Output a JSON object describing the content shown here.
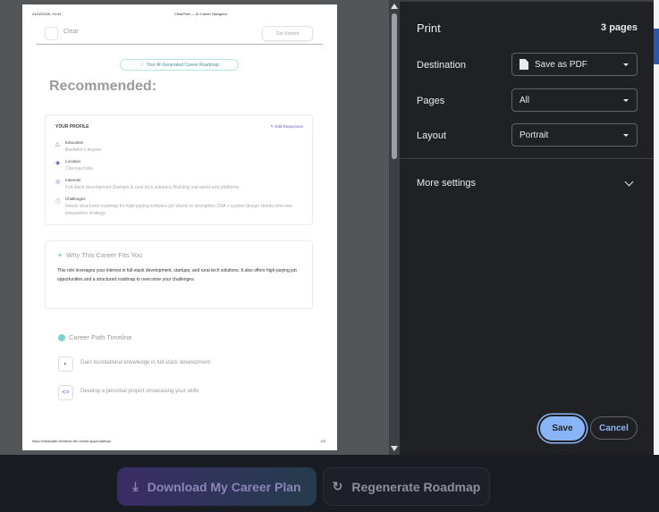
{
  "app": {
    "download_label": "Download My Career Plan",
    "regenerate_label": "Regenerate Roadmap"
  },
  "dialog": {
    "title": "Print",
    "page_count": "3 pages",
    "destination": {
      "label": "Destination",
      "value": "Save as PDF"
    },
    "pages": {
      "label": "Pages",
      "value": "All"
    },
    "layout": {
      "label": "Layout",
      "value": "Portrait"
    },
    "more_settings": "More settings",
    "save_label": "Save",
    "cancel_label": "Cancel",
    "accent_color": "#8ab4f8"
  },
  "preview": {
    "header_date": "24/02/2026, 03:44",
    "header_title": "ClearPath — AI Career Navigator",
    "logo_text": "Clear",
    "get_started": "Get Started",
    "badge": "Your AI-Generated Career Roadmap",
    "heading": "Recommended:",
    "profile": {
      "title": "YOUR PROFILE",
      "edit": "Edit Responses",
      "items": [
        {
          "label": "Education",
          "value": "Bachelor's degree",
          "icon": "graduation-cap-icon"
        },
        {
          "label": "Location",
          "value": "Chennai,India",
          "icon": "map-pin-icon"
        },
        {
          "label": "Interests",
          "value": "Full-stack development Startups & rural tech solutions Building real-world web platforms",
          "icon": "globe-icon"
        },
        {
          "label": "Challenges",
          "value": "Needs structured roadmap for high-paying software job Wants to strengthen DSA + system design Needs interview preparation strategy",
          "icon": "info-icon"
        }
      ]
    },
    "why": {
      "title": "Why This Career Fits You",
      "body": "This role leverages your interest in full-stack development, startups, and rural tech solutions. It also offers high-paying job opportunities and a structured roadmap to overcome your challenges."
    },
    "timeline": {
      "title": "Career Path Timeline",
      "steps": [
        {
          "text": "Gain foundational knowledge in full-stack development",
          "icon": "palette-icon"
        },
        {
          "text": "Develop a personal project showcasing your skills",
          "icon": "code-icon"
        }
      ]
    },
    "footer_url": "https://clearpath-frontend-ten.vercel.app/roadmap",
    "footer_page": "1/3"
  }
}
